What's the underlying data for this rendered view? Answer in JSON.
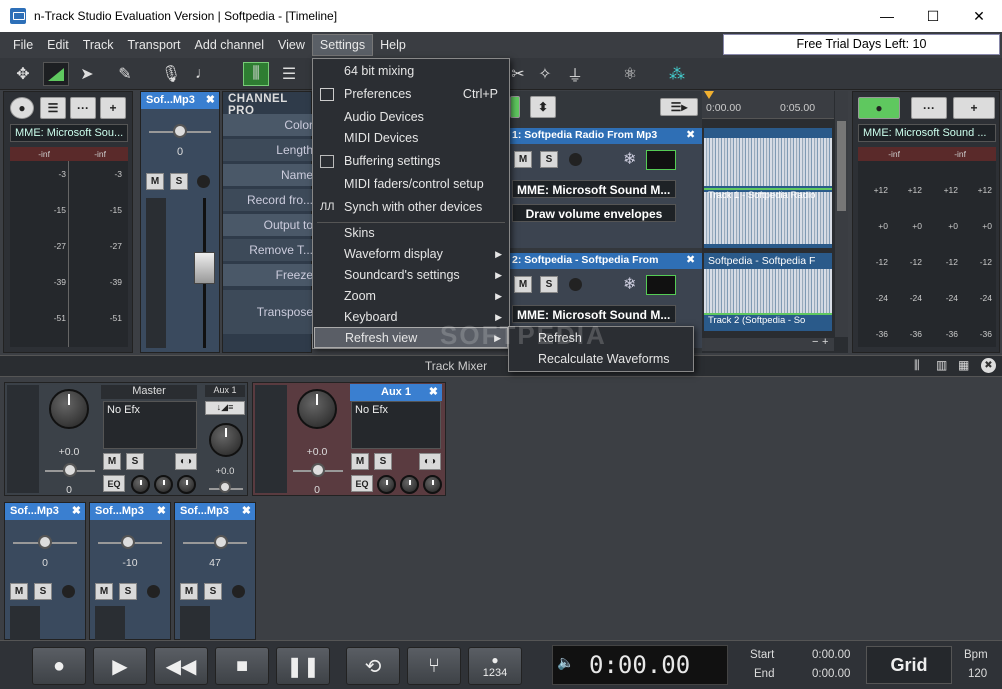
{
  "window": {
    "title": "n-Track Studio Evaluation Version | Softpedia - [Timeline]",
    "minimize": "—",
    "maximize": "☐",
    "close": "✕"
  },
  "menubar": {
    "items": [
      "File",
      "Edit",
      "Track",
      "Transport",
      "Add channel",
      "View",
      "Settings",
      "Help"
    ],
    "active": "Settings"
  },
  "trial": {
    "text": "Free Trial Days Left: 10"
  },
  "toolbar": {
    "icons": [
      "move-icon",
      "envelope-icon",
      "pointer-icon",
      "pencil-icon",
      "microphone-icon",
      "metronome-icon",
      "mixer-icon",
      "list-icon",
      "split-icon",
      "magic-icon",
      "plug-icon",
      "fx-icon",
      "network-icon"
    ]
  },
  "left_channel": {
    "device": "MME: Microsoft Sou...",
    "meter_top": [
      "-inf",
      "-inf"
    ],
    "scale": [
      "-3",
      "-15",
      "-27",
      "-39",
      "-51"
    ]
  },
  "channel_strip": {
    "name": "Sof...Mp3",
    "value": "0",
    "mute": "M",
    "solo": "S"
  },
  "channel_properties": {
    "title": "CHANNEL PRO",
    "rows": [
      "Color",
      "Length",
      "Name",
      "Record fro...",
      "Output to",
      "Remove T...",
      "Freeze",
      "Transpose"
    ]
  },
  "tracks": [
    {
      "name": "1: Softpedia Radio From Mp3",
      "device": "MME: Microsoft Sound M...",
      "action": "Draw volume envelopes",
      "mute": "M",
      "solo": "S"
    },
    {
      "name": "2: Softpedia - Softpedia From",
      "device": "MME: Microsoft Sound M...",
      "mute": "M",
      "solo": "S"
    }
  ],
  "timeline": {
    "ticks": [
      "0:00.00",
      "0:05.00"
    ],
    "clip1": "Track 1 - Softpedia Radio",
    "clip2_title": "Softpedia - Softpedia F",
    "clip2": "Track 2 (Softpedia - So"
  },
  "right_channel": {
    "device": "MME: Microsoft Sound ...",
    "meter_top": [
      "-inf",
      "-inf"
    ],
    "scale": [
      "+12",
      "+0",
      "-12",
      "-24",
      "-36"
    ]
  },
  "settings_menu": {
    "items": [
      {
        "label": "64 bit mixing"
      },
      {
        "label": "Preferences",
        "shortcut": "Ctrl+P"
      },
      {
        "label": "Audio Devices"
      },
      {
        "label": "MIDI Devices"
      },
      {
        "label": "Buffering settings"
      },
      {
        "label": "MIDI faders/control setup"
      },
      {
        "label": "Synch with other devices"
      },
      {
        "label": "Skins"
      },
      {
        "label": "Waveform display"
      },
      {
        "label": "Soundcard's settings"
      },
      {
        "label": "Zoom"
      },
      {
        "label": "Keyboard"
      },
      {
        "label": "Refresh view"
      }
    ]
  },
  "refresh_submenu": {
    "items": [
      "Refresh",
      "Recalculate Waveforms"
    ]
  },
  "watermark": "SOFTPEDIA",
  "mixer": {
    "title": "Track Mixer",
    "master": {
      "name": "Master",
      "efx": "No Efx",
      "gain": "+0.0",
      "pan": "0",
      "mute": "M",
      "solo": "S",
      "eq": "EQ"
    },
    "aux_small": {
      "name": "Aux 1",
      "gain": "+0.0",
      "pan": "0"
    },
    "aux1": {
      "name": "Aux 1",
      "efx": "No Efx",
      "gain": "+0.0",
      "pan": "0",
      "mute": "M",
      "solo": "S",
      "eq": "EQ"
    },
    "channels": [
      {
        "name": "Sof...Mp3",
        "value": "0",
        "mute": "M",
        "solo": "S"
      },
      {
        "name": "Sof...Mp3",
        "value": "-10",
        "mute": "M",
        "solo": "S"
      },
      {
        "name": "Sof...Mp3",
        "value": "47",
        "mute": "M",
        "solo": "S"
      }
    ]
  },
  "transport": {
    "time": "0:00.00",
    "start_label": "Start",
    "start_value": "0:00.00",
    "end_label": "End",
    "end_value": "0:00.00",
    "grid": "Grid",
    "bpm_label": "Bpm",
    "bpm_value": "120",
    "counter": "1234"
  }
}
